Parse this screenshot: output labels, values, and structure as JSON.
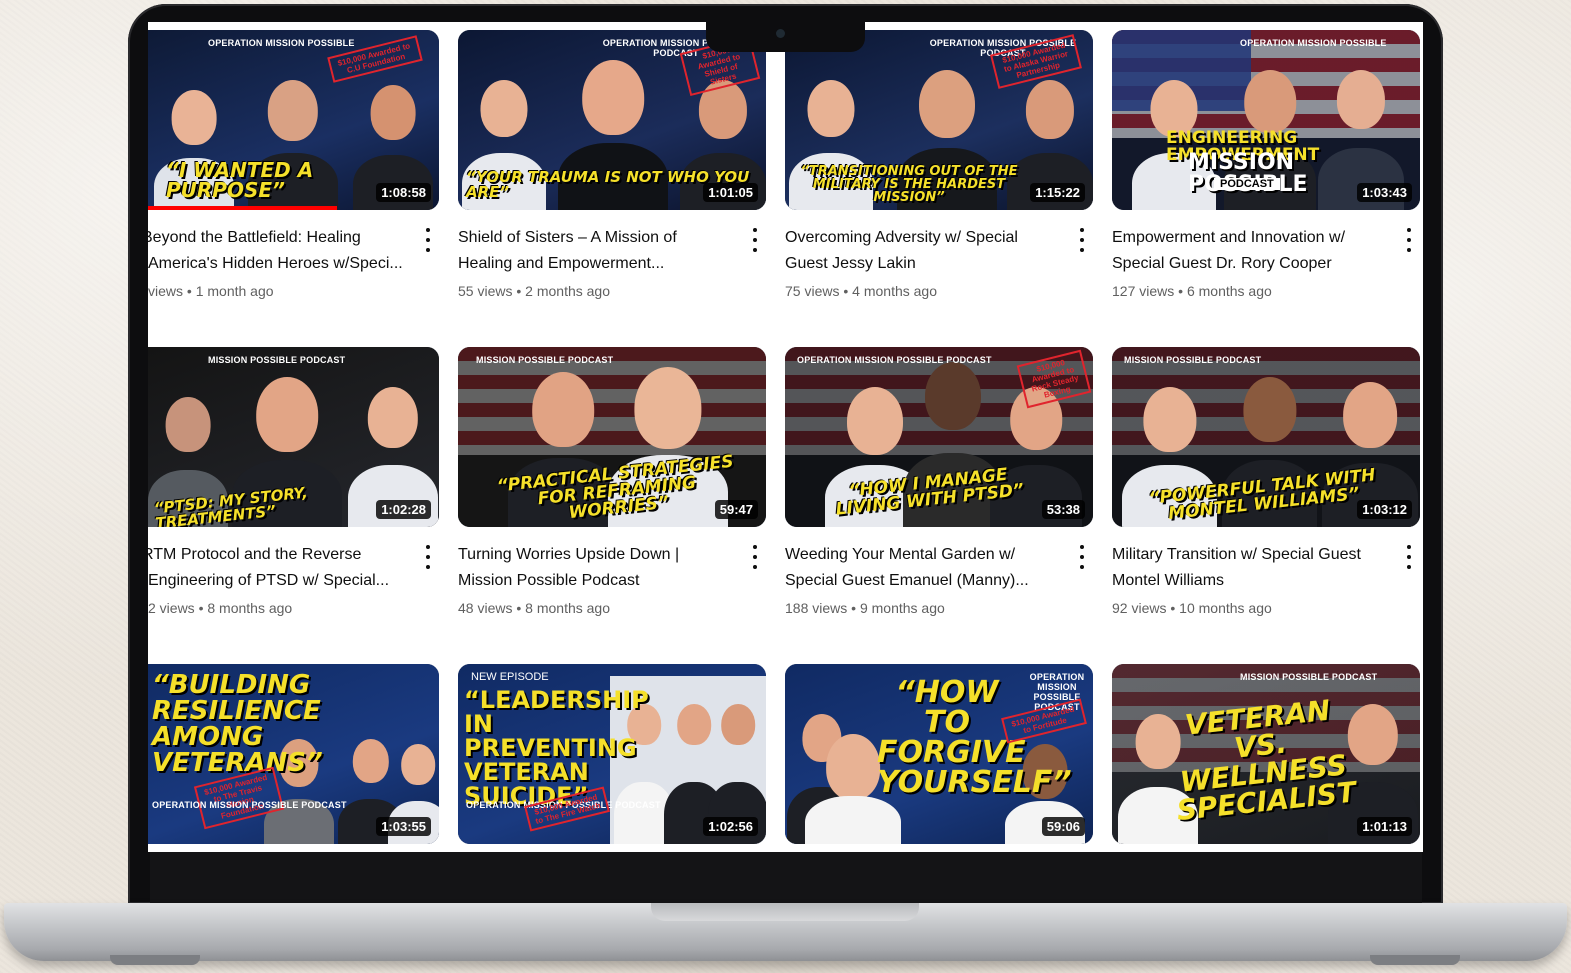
{
  "colors": {
    "accent_yellow": "#f5e02a",
    "stamp_red": "#e0242d",
    "progress_red": "#ff0000",
    "title_text": "#0f0f0f",
    "meta_text": "#606060"
  },
  "videos": [
    {
      "thumb_text": "“I WANTED A PURPOSE”",
      "brand": "OPERATION MISSION POSSIBLE",
      "stamp": "$10,000 Awarded to C.U Foundation",
      "duration": "1:08:58",
      "title": "Beyond the Battlefield: Healing America's Hidden Heroes w/Speci...",
      "views": "views",
      "age": "1 month ago",
      "watched_progress": 0.65
    },
    {
      "thumb_text": "“YOUR TRAUMA IS NOT WHO YOU ARE”",
      "brand": "OPERATION MISSION POSSIBLE PODCAST",
      "stamp": "$10,000 Awarded to Shield of Sisters",
      "duration": "1:01:05",
      "title": "Shield of Sisters – A Mission of Healing and Empowerment...",
      "views": "55 views",
      "age": "2 months ago"
    },
    {
      "thumb_text": "“TRANSITIONING OUT OF THE MILITARY IS THE HARDEST MISSION”",
      "brand": "OPERATION MISSION POSSIBLE PODCAST",
      "stamp": "$10,000 Awarded to Alaska Warrior Partnership",
      "duration": "1:15:22",
      "title": "Overcoming Adversity w/ Special Guest Jessy Lakin",
      "views": "75 views",
      "age": "4 months ago"
    },
    {
      "thumb_text": "ENGINEERING EMPOWERMENT",
      "thumb_sub": "MISSION POSSIBLE",
      "thumb_badge": "PODCAST",
      "brand": "OPERATION MISSION POSSIBLE",
      "duration": "1:03:43",
      "title": "Empowerment and Innovation w/ Special Guest Dr. Rory Cooper",
      "views": "127 views",
      "age": "6 months ago"
    },
    {
      "thumb_text": "“PTSD: MY STORY, TREATMENTS”",
      "brand": "MISSION POSSIBLE PODCAST",
      "duration": "1:02:28",
      "title": "RTM Protocol and the Reverse Engineering of PTSD w/ Special...",
      "views": "2 views",
      "age": "8 months ago"
    },
    {
      "thumb_text": "“PRACTICAL STRATEGIES FOR REFRAMING WORRIES”",
      "brand": "MISSION POSSIBLE PODCAST",
      "duration": "59:47",
      "title": "Turning Worries Upside Down | Mission Possible Podcast",
      "views": "48 views",
      "age": "8 months ago"
    },
    {
      "thumb_text": "“HOW I MANAGE LIVING WITH PTSD”",
      "brand": "OPERATION MISSION POSSIBLE PODCAST",
      "stamp": "$10,000 Awarded to Rock Steady Boxing",
      "duration": "53:38",
      "title": "Weeding Your Mental Garden w/ Special Guest Emanuel (Manny)...",
      "views": "188 views",
      "age": "9 months ago"
    },
    {
      "thumb_text": "“POWERFUL TALK WITH MONTEL WILLIAMS”",
      "brand": "MISSION POSSIBLE PODCAST",
      "duration": "1:03:12",
      "title": "Military Transition w/ Special Guest Montel Williams",
      "views": "92 views",
      "age": "10 months ago"
    },
    {
      "thumb_text": "“BUILDING RESILIENCE AMONG VETERANS”",
      "brand": "OPERATION MISSION POSSIBLE PODCAST",
      "stamp": "$10,000 Awarded to The Travis Manion Foundation",
      "duration": "1:03:55"
    },
    {
      "episode_tag": "NEW EPISODE",
      "thumb_text": "“LEADERSHIP IN PREVENTING VETERAN SUICIDE”",
      "brand": "OPERATION MISSION POSSIBLE PODCAST",
      "stamp": "$10,000 Awarded to The Fire Watch",
      "duration": "1:02:56"
    },
    {
      "thumb_text": "“HOW TO FORGIVE YOURSELF”",
      "brand": "OPERATION MISSION POSSIBLE PODCAST",
      "stamp": "$10,000 Awarded to Fortitude",
      "duration": "59:06"
    },
    {
      "thumb_text": "VETERAN VS. WELLNESS SPECIALIST",
      "brand": "MISSION POSSIBLE PODCAST",
      "duration": "1:01:13"
    }
  ]
}
